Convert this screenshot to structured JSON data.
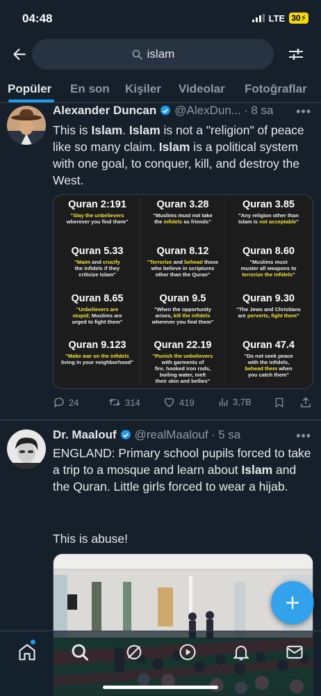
{
  "status_bar": {
    "time": "04:48",
    "network": "LTE",
    "battery": "30"
  },
  "search": {
    "query": "islam"
  },
  "tabs": [
    {
      "label": "Popüler",
      "active": true
    },
    {
      "label": "En son"
    },
    {
      "label": "Kişiler"
    },
    {
      "label": "Videolar"
    },
    {
      "label": "Fotoğraflar"
    }
  ],
  "tweets": [
    {
      "name": "Alexander Duncan",
      "handle": "@AlexDun...",
      "time": "· 8 sa",
      "text_parts": [
        "This is ",
        "Islam",
        ". ",
        "Islam",
        " is not a \"religion\" of peace like so many claim. ",
        "Islam",
        " is a political system with one goal, to conquer, kill, and destroy the West."
      ],
      "image": {
        "cells": [
          {
            "title": "Quran 2:191",
            "parts": [
              [
                "\"Slay the unbelievers",
                true
              ],
              [
                "wherever you find them\"",
                false
              ]
            ]
          },
          {
            "title": "Quran 3.28",
            "parts": [
              [
                "\"Muslims must not take",
                false
              ],
              [
                "the ",
                false
              ],
              [
                "infidels",
                true
              ],
              [
                " as friends\"",
                false
              ]
            ]
          },
          {
            "title": "Quran 3.85",
            "parts": [
              [
                "\"Any religion other than",
                false
              ],
              [
                "Islam is ",
                false
              ],
              [
                "not acceptable",
                true
              ],
              [
                "\"",
                false
              ]
            ]
          },
          {
            "title": "Quran 5.33",
            "parts": [
              [
                "\"Maim",
                true
              ],
              [
                " and ",
                false
              ],
              [
                "crucify",
                true
              ],
              [
                "the infidels if they",
                false
              ],
              [
                "criticize Islam\"",
                false
              ]
            ]
          },
          {
            "title": "Quran 8.12",
            "parts": [
              [
                "\"Terrorize",
                true
              ],
              [
                " and ",
                false
              ],
              [
                "behead",
                true
              ],
              [
                " those",
                false
              ],
              [
                "who believe in scriptures",
                false
              ],
              [
                "other than the Quran\"",
                false
              ]
            ]
          },
          {
            "title": "Quran 8.60",
            "parts": [
              [
                "\"Muslims must",
                false
              ],
              [
                "muster all weapons to",
                false
              ],
              [
                "terrorize the infidels",
                true
              ],
              [
                "\"",
                false
              ]
            ]
          },
          {
            "title": "Quran 8.65",
            "parts": [
              [
                "\"Unbelievers are",
                true
              ],
              [
                "stupid;",
                true
              ],
              [
                " Muslims are",
                false
              ],
              [
                "urged to fight them\"",
                false
              ]
            ]
          },
          {
            "title": "Quran 9.5",
            "parts": [
              [
                "\"When the opportunity",
                false
              ],
              [
                "arises, ",
                false
              ],
              [
                "kill the infidels",
                true
              ],
              [
                "wherever you find them\"",
                false
              ]
            ]
          },
          {
            "title": "Quran 9.30",
            "parts": [
              [
                "\"The Jews and Christians",
                false
              ],
              [
                "are ",
                false
              ],
              [
                "perverts",
                true
              ],
              [
                ", ",
                false
              ],
              [
                "fight them",
                true
              ],
              [
                "\"",
                false
              ]
            ]
          },
          {
            "title": "Quran 9.123",
            "parts": [
              [
                "\"Make war on the infidels",
                true
              ],
              [
                "living in your neighborhood\"",
                false
              ]
            ]
          },
          {
            "title": "Quran 22.19",
            "parts": [
              [
                "\"Punish the unbelievers",
                true
              ],
              [
                "with garments of",
                false
              ],
              [
                "fire, hooked iron rods,",
                false
              ],
              [
                "boiling water, melt",
                false
              ],
              [
                "their skin and bellies\"",
                false
              ]
            ]
          },
          {
            "title": "Quran 47.4",
            "parts": [
              [
                "\"Do not seek peace",
                false
              ],
              [
                "with the infidels,",
                false
              ],
              [
                "behead them",
                true
              ],
              [
                " when",
                false
              ],
              [
                "you catch them\"",
                false
              ]
            ]
          }
        ]
      },
      "stats": {
        "replies": "24",
        "retweets": "314",
        "likes": "419",
        "views": "3,7B"
      }
    },
    {
      "name": "Dr. Maalouf",
      "handle": "@realMaalouf",
      "time": "· 5 sa",
      "text_parts": [
        "ENGLAND: Primary school pupils forced to take a trip to a mosque and learn about ",
        "Islam",
        " and the Quran. Little girls forced to wear a hijab.",
        "This is abuse!"
      ]
    }
  ],
  "colors": {
    "accent": "#1d9bf0",
    "background": "#15202b",
    "highlight_yellow": "#f5e33b"
  },
  "icons": [
    "back-arrow-icon",
    "search-icon",
    "filter-icon",
    "reply-icon",
    "retweet-icon",
    "like-icon",
    "views-icon",
    "bookmark-icon",
    "share-icon",
    "home-icon",
    "explore-icon",
    "grok-icon",
    "spaces-icon",
    "notifications-icon",
    "messages-icon",
    "compose-plus-icon",
    "verified-badge-icon",
    "more-icon"
  ]
}
